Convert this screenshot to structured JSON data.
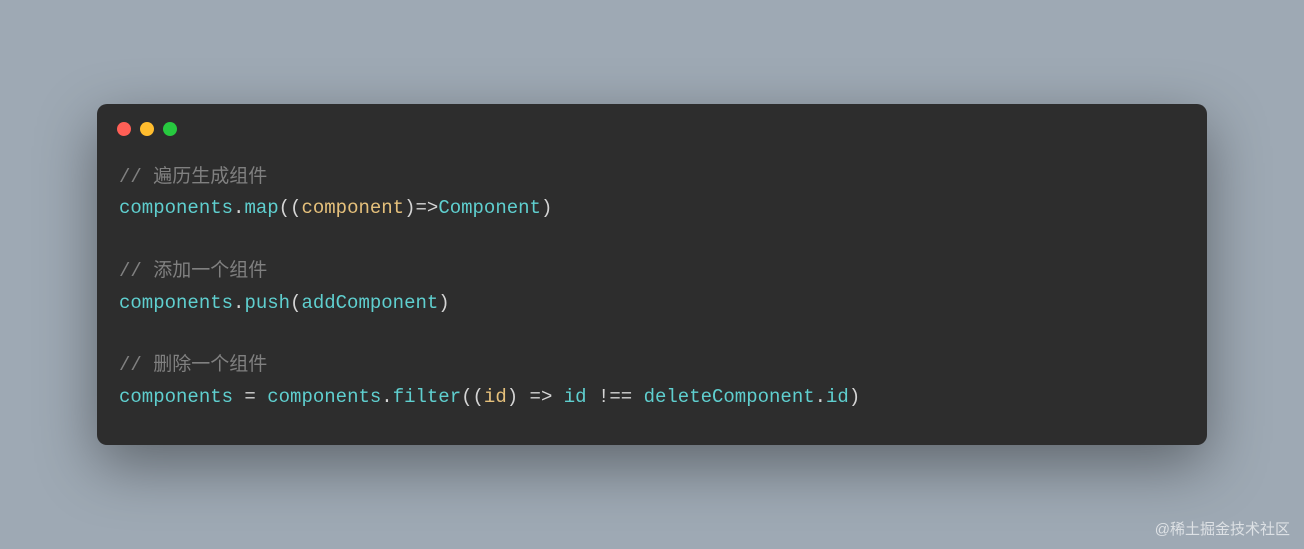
{
  "code": {
    "comment1": "// 遍历生成组件",
    "line1": {
      "obj": "components",
      "method": "map",
      "param": "component",
      "result": "Component"
    },
    "comment2": "// 添加一个组件",
    "line2": {
      "obj": "components",
      "method": "push",
      "arg": "addComponent"
    },
    "comment3": "// 删除一个组件",
    "line3": {
      "lhs": "components",
      "rhs_obj": "components",
      "method": "filter",
      "param": "id",
      "cond_left": "id",
      "cond_op": "!==",
      "cond_right_obj": "deleteComponent",
      "cond_right_prop": "id"
    }
  },
  "watermark": "@稀土掘金技术社区"
}
